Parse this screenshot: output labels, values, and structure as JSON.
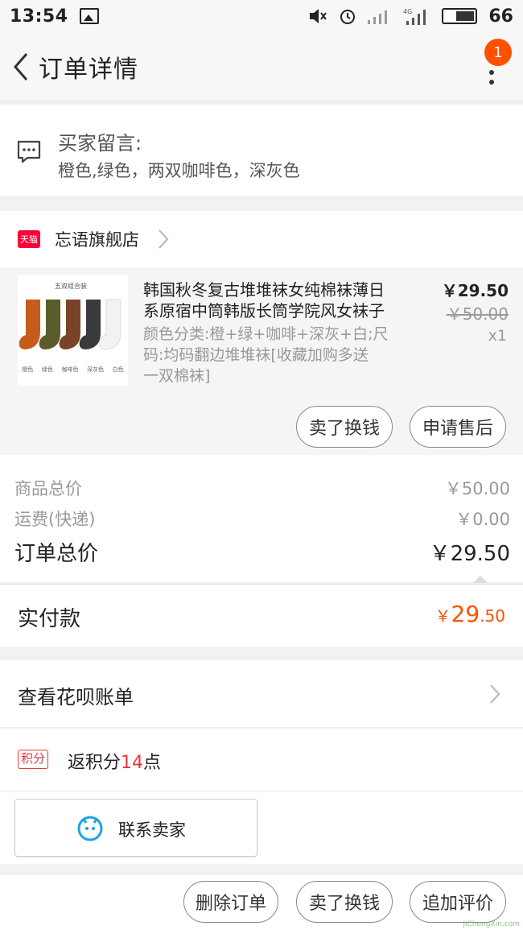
{
  "status_bar": {
    "time": "13:54",
    "battery": "66"
  },
  "nav": {
    "title": "订单详情",
    "badge_count": "1"
  },
  "buyer_message": {
    "label": "买家留言:",
    "text": "橙色,绿色，两双咖啡色，深灰色"
  },
  "shop": {
    "badge": "天猫",
    "name": "忘语旗舰店"
  },
  "product": {
    "image_caption": "五双组合装",
    "image_colors": [
      "橙色",
      "绿色",
      "咖啡色",
      "深灰色",
      "白色"
    ],
    "title_line1": "韩国秋冬复古堆堆袜女纯棉袜薄日",
    "title_line2": "系原宿中筒韩版长筒学院风女袜子",
    "sku_line1": "颜色分类:橙+绿+咖啡+深灰+白;尺",
    "sku_line2": "码:均码翻边堆堆袜[收藏加购多送",
    "sku_line3": "一双棉袜]",
    "price": "￥29.50",
    "original_price": "￥50.00",
    "quantity": "x1",
    "btn_resell": "卖了换钱",
    "btn_after_sale": "申请售后"
  },
  "prices": {
    "goods_total_label": "商品总价",
    "goods_total_value": "￥50.00",
    "shipping_label": "运费(快递)",
    "shipping_value": "￥0.00",
    "order_total_label": "订单总价",
    "order_total_value": "￥29.50"
  },
  "paid": {
    "label": "实付款",
    "currency": "￥",
    "integer": "29",
    "decimal": ".50"
  },
  "huabei": {
    "label": "查看花呗账单"
  },
  "points": {
    "badge": "积分",
    "prefix": "返积分",
    "value": "14",
    "suffix": "点"
  },
  "contact": {
    "label": "联系卖家"
  },
  "bottom_actions": {
    "delete": "删除订单",
    "resell": "卖了换钱",
    "review": "追加评价"
  },
  "watermark": {
    "text": "JiChengXin.com"
  },
  "colors": {
    "accent": "#ff5000",
    "tmall_red": "#ff0036",
    "points_red": "#e4393c",
    "blue_icon": "#1aa3e8"
  }
}
